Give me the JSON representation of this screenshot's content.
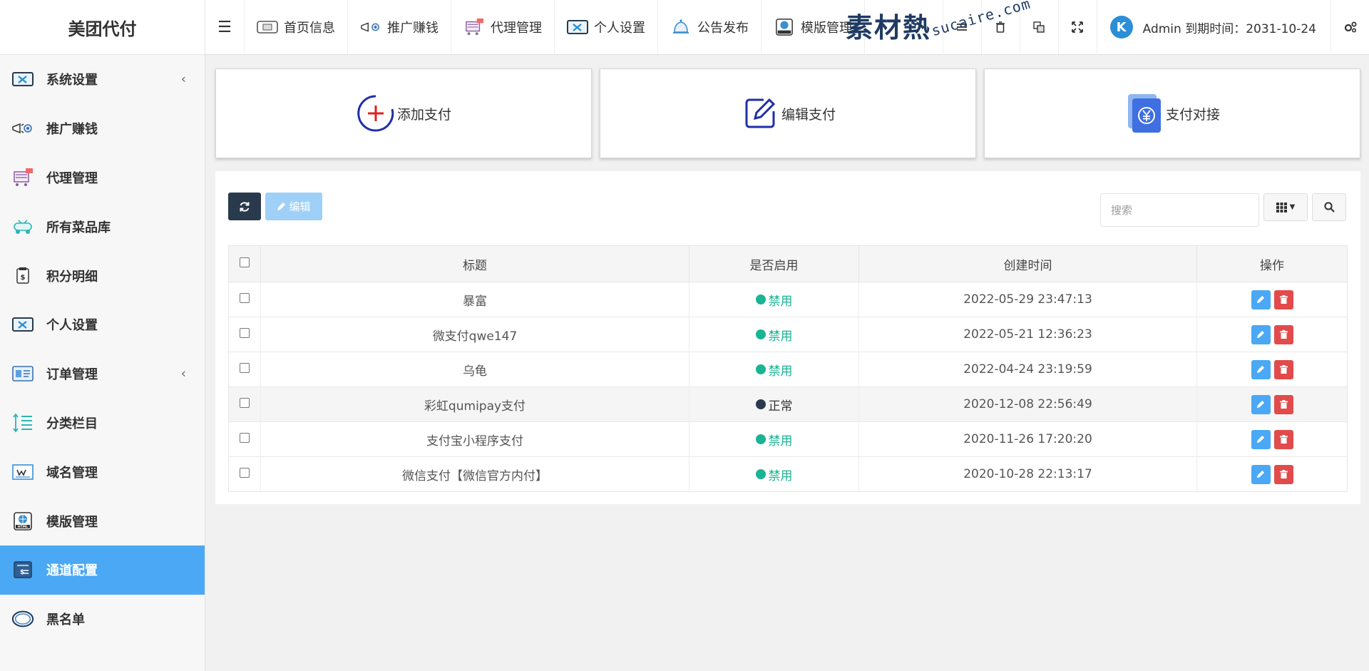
{
  "brand": "美团代付",
  "sidebar": {
    "items": [
      {
        "label": "系统设置",
        "icon": "settings-panel-icon",
        "expandable": true
      },
      {
        "label": "推广赚钱",
        "icon": "megaphone-icon",
        "expandable": false
      },
      {
        "label": "代理管理",
        "icon": "agent-cart-icon",
        "expandable": false
      },
      {
        "label": "所有菜品库",
        "icon": "dish-library-icon",
        "expandable": false
      },
      {
        "label": "积分明细",
        "icon": "points-icon",
        "expandable": false
      },
      {
        "label": "个人设置",
        "icon": "personal-settings-icon",
        "expandable": false
      },
      {
        "label": "订单管理",
        "icon": "order-icon",
        "expandable": true
      },
      {
        "label": "分类栏目",
        "icon": "category-icon",
        "expandable": false
      },
      {
        "label": "域名管理",
        "icon": "domain-icon",
        "expandable": false
      },
      {
        "label": "模版管理",
        "icon": "template-html-icon",
        "expandable": false
      },
      {
        "label": "通道配置",
        "icon": "channel-config-icon",
        "expandable": false,
        "active": true
      },
      {
        "label": "黑名单",
        "icon": "blacklist-icon",
        "expandable": false
      }
    ]
  },
  "topbar": {
    "nav": [
      {
        "label": "首页信息"
      },
      {
        "label": "推广赚钱"
      },
      {
        "label": "代理管理"
      },
      {
        "label": "个人设置"
      },
      {
        "label": "公告发布"
      },
      {
        "label": "模版管理"
      }
    ],
    "user": "Admin 到期时间：2031-10-24",
    "avatar_letter": "K"
  },
  "watermark": {
    "main": "素材熱",
    "sub": "sucaire.com"
  },
  "cards": [
    {
      "label": "添加支付"
    },
    {
      "label": "编辑支付"
    },
    {
      "label": "支付对接"
    }
  ],
  "toolbar": {
    "edit_label": "编辑"
  },
  "search": {
    "placeholder": "搜索"
  },
  "table": {
    "headers": [
      "标题",
      "是否启用",
      "创建时间",
      "操作"
    ],
    "rows": [
      {
        "title": "暴富",
        "status": "禁用",
        "created": "2022-05-29 23:47:13"
      },
      {
        "title": "微支付qwe147",
        "status": "禁用",
        "created": "2022-05-21 12:36:23"
      },
      {
        "title": "乌龟",
        "status": "禁用",
        "created": "2022-04-24 23:19:59"
      },
      {
        "title": "彩虹qumipay支付",
        "status": "正常",
        "created": "2020-12-08 22:56:49"
      },
      {
        "title": "支付宝小程序支付",
        "status": "禁用",
        "created": "2020-11-26 17:20:20"
      },
      {
        "title": "微信支付【微信官方内付】",
        "status": "禁用",
        "created": "2020-10-28 22:13:17"
      }
    ]
  },
  "colors": {
    "accent": "#4aa8f5",
    "status_green": "#1ab394",
    "dark": "#2a3a4d",
    "danger": "#e14b4b"
  }
}
